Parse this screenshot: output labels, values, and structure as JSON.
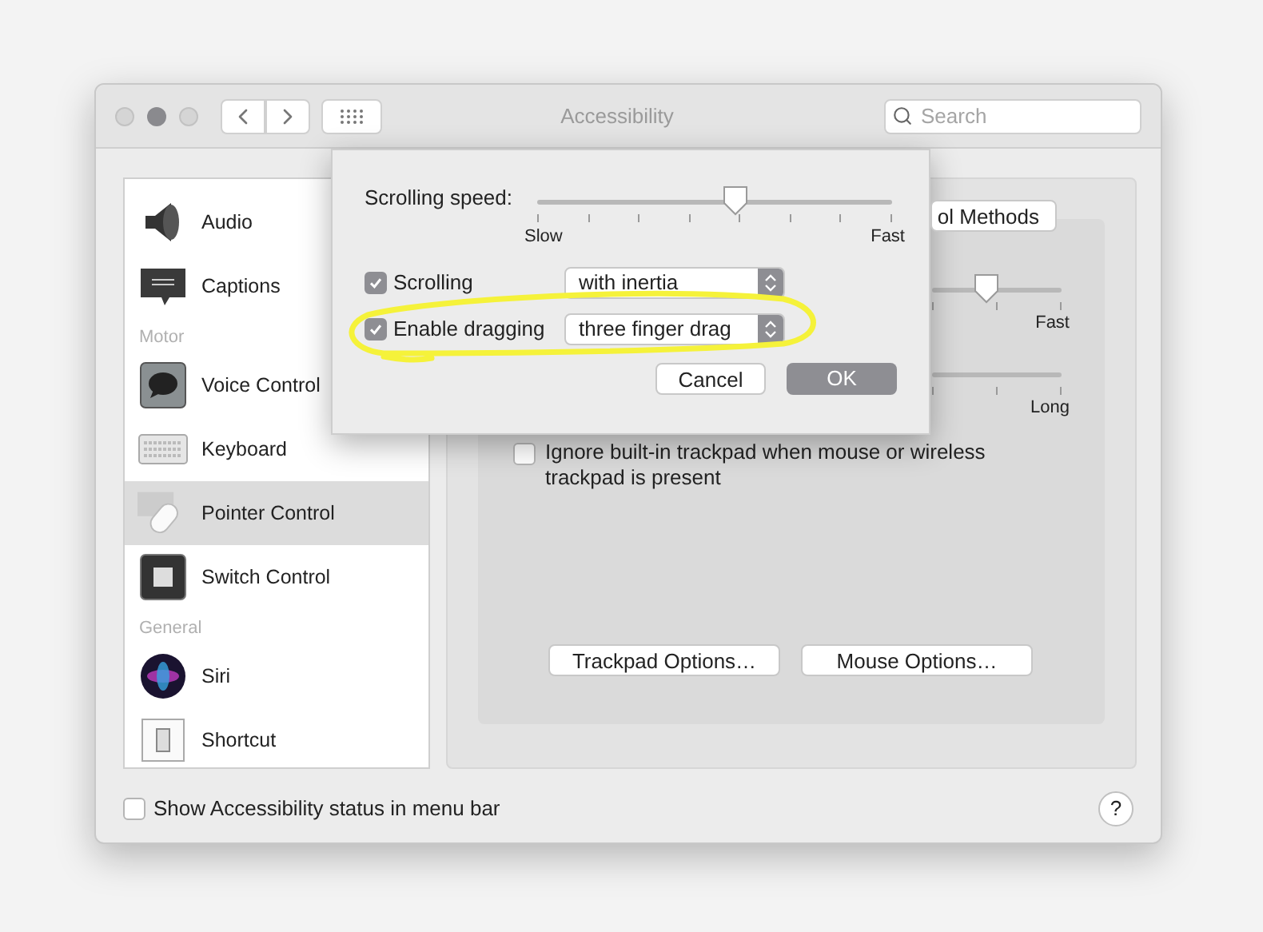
{
  "window": {
    "title": "Accessibility",
    "search": {
      "placeholder": "Search"
    }
  },
  "sidebar": {
    "items": [
      {
        "kind": "item",
        "label": "Audio",
        "selected": false
      },
      {
        "kind": "item",
        "label": "Captions",
        "selected": false
      },
      {
        "kind": "header",
        "label": "Motor"
      },
      {
        "kind": "item",
        "label": "Voice Control",
        "selected": false
      },
      {
        "kind": "item",
        "label": "Keyboard",
        "selected": false
      },
      {
        "kind": "item",
        "label": "Pointer Control",
        "selected": true
      },
      {
        "kind": "item",
        "label": "Switch Control",
        "selected": false
      },
      {
        "kind": "header",
        "label": "General"
      },
      {
        "kind": "item",
        "label": "Siri",
        "selected": false
      },
      {
        "kind": "item",
        "label": "Shortcut",
        "selected": false
      }
    ]
  },
  "panel": {
    "top_button": "ol Methods",
    "slider_1": {
      "level": 0.42,
      "max_label": "Fast"
    },
    "slider_2": {
      "max_label": "Long"
    },
    "ignore_trackpad": {
      "label": "Ignore built-in trackpad when mouse or wireless trackpad is present",
      "checked": false
    },
    "buttons": [
      "Trackpad Options…",
      "Mouse Options…"
    ]
  },
  "footer": {
    "status_checkbox": {
      "label": "Show Accessibility status in menu bar",
      "checked": false
    },
    "help": "?"
  },
  "sheet": {
    "speed": {
      "label": "Scrolling speed:",
      "level": 0.56,
      "min_label": "Slow",
      "max_label": "Fast"
    },
    "options": [
      {
        "label": "Scrolling",
        "checked": true,
        "value": "with inertia"
      },
      {
        "label": "Enable dragging",
        "checked": true,
        "value": "three finger drag"
      }
    ],
    "buttons": [
      {
        "label": "Cancel",
        "default": false
      },
      {
        "label": "OK",
        "default": true
      }
    ]
  }
}
